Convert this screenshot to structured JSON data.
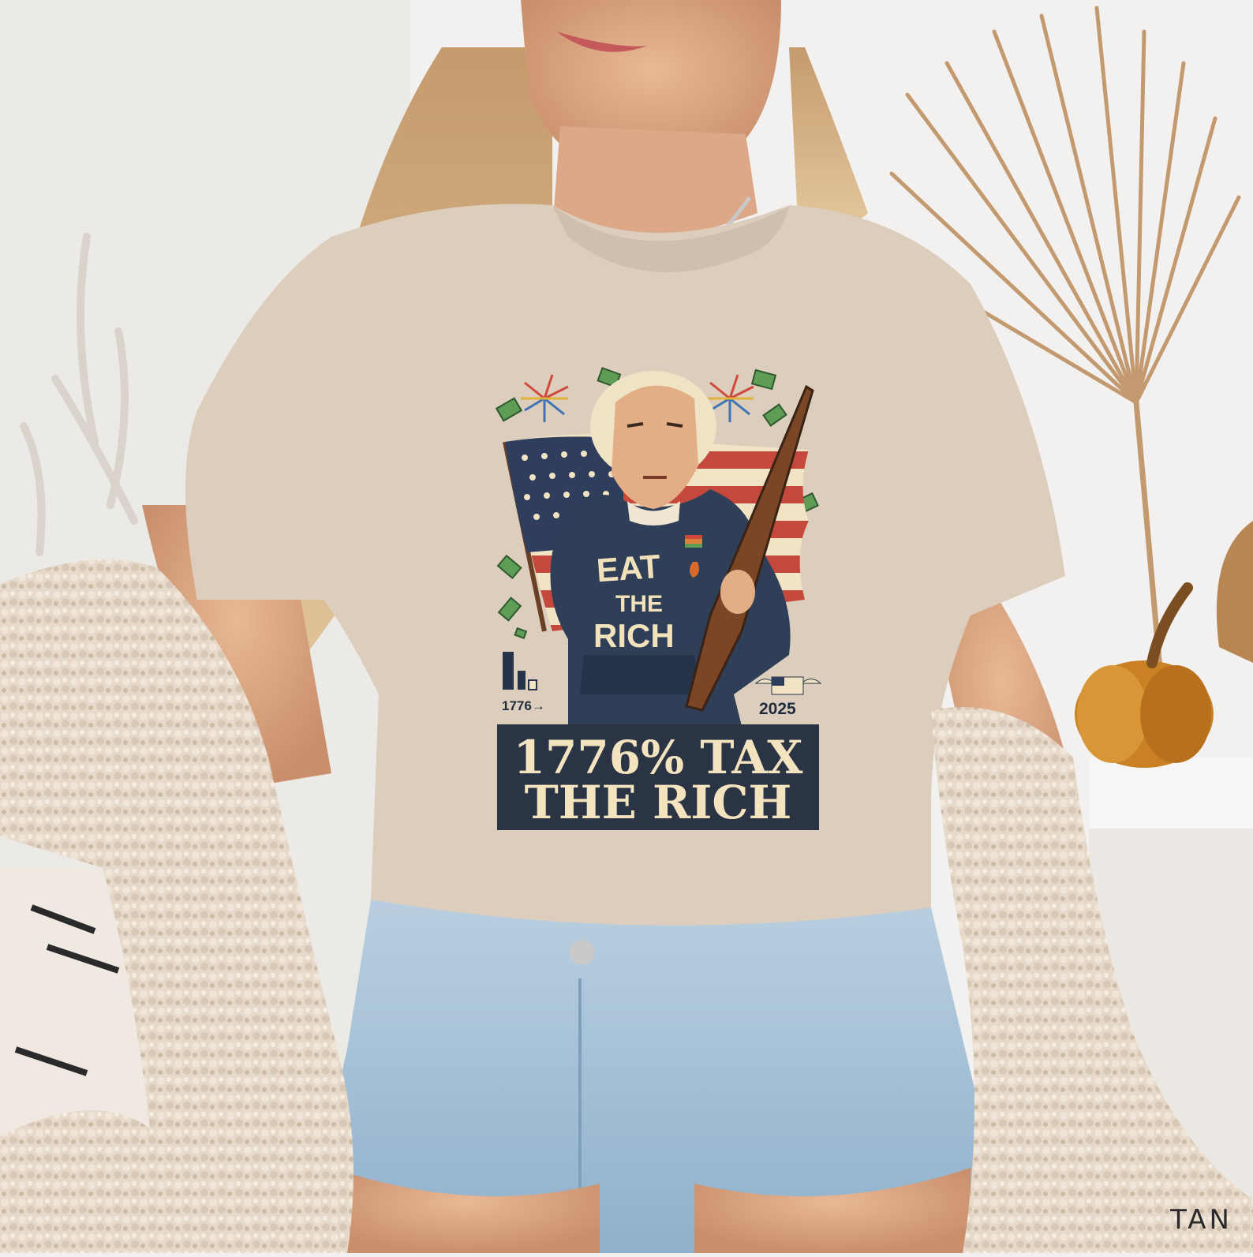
{
  "photo": {
    "subject": "woman wearing printed graphic tee",
    "colors": {
      "background": "#f2f0ee",
      "shirt": "#dccdbd",
      "hoodie": "#2f3f57",
      "slogan_box": "#2b3445",
      "cream_text": "#f2e2bc",
      "flag_red": "#c4483b",
      "rifle": "#7a4626"
    }
  },
  "print": {
    "hoodie_line1": "EAT",
    "hoodie_line2": "THE",
    "hoodie_line3": "RICH",
    "chart_label": "1776→",
    "year_label": "2025",
    "slogan_line1": "1776% TAX",
    "slogan_line2": "THE RICH"
  },
  "color_tag": "TAN"
}
